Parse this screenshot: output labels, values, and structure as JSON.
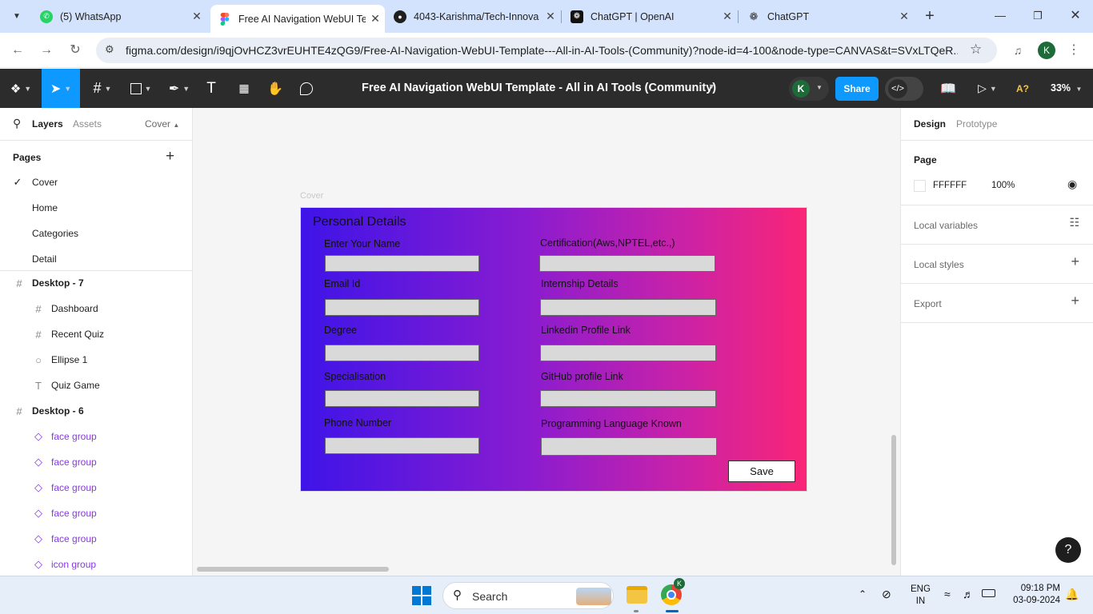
{
  "browser": {
    "tabs": [
      {
        "title": "(5) WhatsApp",
        "icon": "whatsapp-icon",
        "active": false
      },
      {
        "title": "Free AI Navigation WebUI Te",
        "icon": "figma-icon",
        "active": true
      },
      {
        "title": "4043-Karishma/Tech-Innova",
        "icon": "github-icon",
        "active": false
      },
      {
        "title": "ChatGPT | OpenAI",
        "icon": "openai-icon",
        "active": false
      },
      {
        "title": "ChatGPT",
        "icon": "openai-icon",
        "active": false
      }
    ],
    "url": "figma.com/design/i9qjOvHCZ3vrEUHTE4zQG9/Free-AI-Navigation-WebUI-Template---All-in-AI-Tools-(Community)?node-id=4-100&node-type=CANVAS&t=SVxLTQeR...",
    "profile_initial": "K"
  },
  "toolbar": {
    "file_title": "Free AI Navigation WebUI Template - All in AI Tools (Community)",
    "user_initial": "K",
    "share_label": "Share",
    "zoom": "33%",
    "font_warning": "A?"
  },
  "left_panel": {
    "tabs": {
      "layers": "Layers",
      "assets": "Assets",
      "page_selector": "Cover"
    },
    "pages_header": "Pages",
    "pages": [
      "Cover",
      "Home",
      "Categories",
      "Detail"
    ],
    "layers": [
      {
        "name": "Desktop - 7",
        "type": "frame",
        "level": 0
      },
      {
        "name": "Dashboard",
        "type": "frame",
        "level": 1
      },
      {
        "name": "Recent Quiz",
        "type": "frame",
        "level": 1
      },
      {
        "name": "Ellipse 1",
        "type": "ellipse",
        "level": 1
      },
      {
        "name": "Quiz Game",
        "type": "text",
        "level": 1
      },
      {
        "name": "Desktop - 6",
        "type": "frame",
        "level": 0
      },
      {
        "name": "face group",
        "type": "component",
        "level": 1
      },
      {
        "name": "face group",
        "type": "component",
        "level": 1
      },
      {
        "name": "face group",
        "type": "component",
        "level": 1
      },
      {
        "name": "face group",
        "type": "component",
        "level": 1
      },
      {
        "name": "face group",
        "type": "component",
        "level": 1
      },
      {
        "name": "icon group",
        "type": "component",
        "level": 1
      }
    ]
  },
  "canvas": {
    "frame_label": "Cover",
    "form": {
      "title": "Personal Details",
      "left_fields": [
        "Enter Your Name",
        "Email Id",
        "Degree",
        "Specialisation",
        "Phone Number"
      ],
      "right_fields": [
        "Certification(Aws,NPTEL,etc.,)",
        "Internship Details",
        "Linkedin Profile Link",
        "GitHub profile Link",
        "Programming Language Known"
      ],
      "save_label": "Save",
      "gradient_start": "#3e14e8",
      "gradient_end": "#fa2576"
    }
  },
  "right_panel": {
    "tabs": {
      "design": "Design",
      "prototype": "Prototype"
    },
    "page_section": "Page",
    "page_color": "FFFFFF",
    "page_opacity": "100%",
    "sections": [
      "Local variables",
      "Local styles",
      "Export"
    ]
  },
  "taskbar": {
    "search_placeholder": "Search",
    "lang": "ENG",
    "region": "IN",
    "time": "09:18 PM",
    "date": "03-09-2024",
    "profile_initial": "K"
  }
}
